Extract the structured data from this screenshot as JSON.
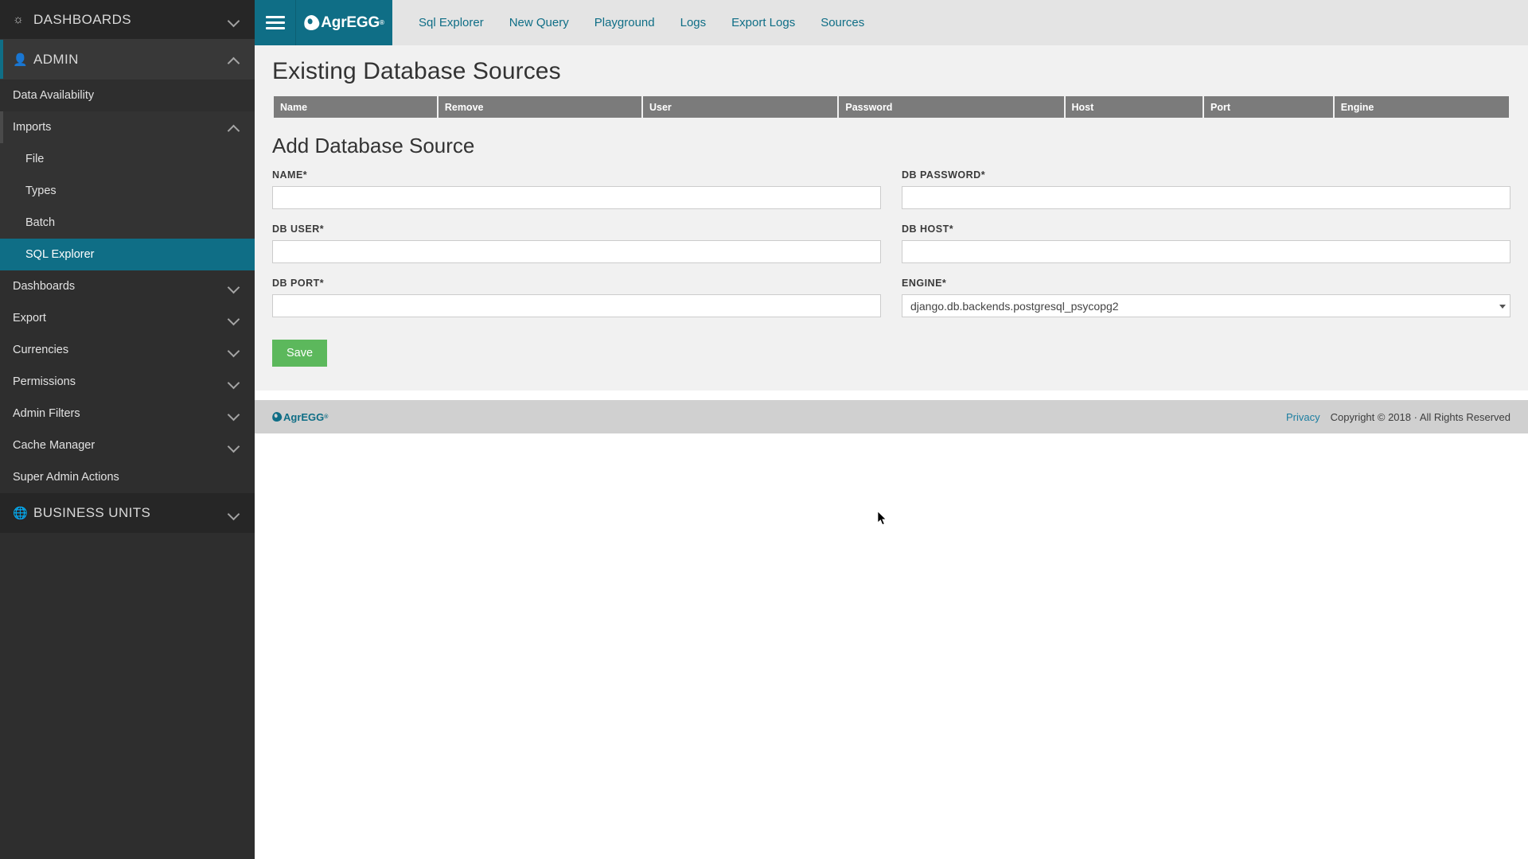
{
  "sidebar": {
    "sections": [
      {
        "label": "DASHBOARDS",
        "icon": "speedometer-icon",
        "glyph": "☸",
        "state": "collapsed",
        "style": "dark"
      },
      {
        "label": "ADMIN",
        "icon": "user-add-icon",
        "glyph": "☺",
        "state": "expanded",
        "style": "grey"
      }
    ],
    "admin_items": [
      {
        "label": "Data Availability",
        "level": 1,
        "expandable": false,
        "state": "none"
      },
      {
        "label": "Imports",
        "level": 1,
        "expandable": true,
        "state": "expanded"
      },
      {
        "label": "File",
        "level": 2,
        "expandable": false,
        "state": "none"
      },
      {
        "label": "Types",
        "level": 2,
        "expandable": false,
        "state": "none"
      },
      {
        "label": "Batch",
        "level": 2,
        "expandable": false,
        "state": "none"
      },
      {
        "label": "SQL Explorer",
        "level": 2,
        "expandable": false,
        "state": "selected"
      },
      {
        "label": "Dashboards",
        "level": 1,
        "expandable": true,
        "state": "collapsed"
      },
      {
        "label": "Export",
        "level": 1,
        "expandable": true,
        "state": "collapsed"
      },
      {
        "label": "Currencies",
        "level": 1,
        "expandable": true,
        "state": "collapsed"
      },
      {
        "label": "Permissions",
        "level": 1,
        "expandable": true,
        "state": "collapsed"
      },
      {
        "label": "Admin Filters",
        "level": 1,
        "expandable": true,
        "state": "collapsed"
      },
      {
        "label": "Cache Manager",
        "level": 1,
        "expandable": true,
        "state": "collapsed"
      },
      {
        "label": "Super Admin Actions",
        "level": 1,
        "expandable": false,
        "state": "none"
      }
    ],
    "business_units": {
      "label": "BUSINESS UNITS",
      "icon": "globe-icon",
      "glyph": "⊕",
      "state": "collapsed"
    }
  },
  "topbar": {
    "menu_icon": "hamburger-icon",
    "brand": "AgrEGG",
    "brand_mark": "®",
    "links": [
      {
        "label": "Sql Explorer"
      },
      {
        "label": "New Query"
      },
      {
        "label": "Playground"
      },
      {
        "label": "Logs"
      },
      {
        "label": "Export Logs"
      },
      {
        "label": "Sources"
      }
    ]
  },
  "main": {
    "page_title": "Existing Database Sources",
    "table": {
      "columns": [
        "Name",
        "Remove",
        "User",
        "Password",
        "Host",
        "Port",
        "Engine"
      ],
      "rows": []
    },
    "form_title": "Add Database Source",
    "fields": [
      {
        "key": "name",
        "label": "NAME*",
        "value": "",
        "type": "text"
      },
      {
        "key": "password",
        "label": "DB PASSWORD*",
        "value": "",
        "type": "text"
      },
      {
        "key": "user",
        "label": "DB USER*",
        "value": "",
        "type": "text"
      },
      {
        "key": "host",
        "label": "DB HOST*",
        "value": "",
        "type": "text"
      },
      {
        "key": "port",
        "label": "DB PORT*",
        "value": "",
        "type": "text"
      },
      {
        "key": "engine",
        "label": "ENGINE*",
        "value": "django.db.backends.postgresql_psycopg2",
        "type": "select"
      }
    ],
    "save_label": "Save"
  },
  "footer": {
    "brand": "AgrEGG",
    "brand_mark": "®",
    "privacy": "Privacy",
    "copyright": "Copyright © 2018 · All Rights Reserved"
  },
  "colors": {
    "accent": "#0f6e86",
    "sidebar_bg": "#2e2e2e",
    "selected": "#0f6e86",
    "save_green": "#5cb85c",
    "table_header": "#7b7b7b",
    "panel_bg": "#f1f1f1",
    "footer_bg": "#d0d0d0"
  }
}
